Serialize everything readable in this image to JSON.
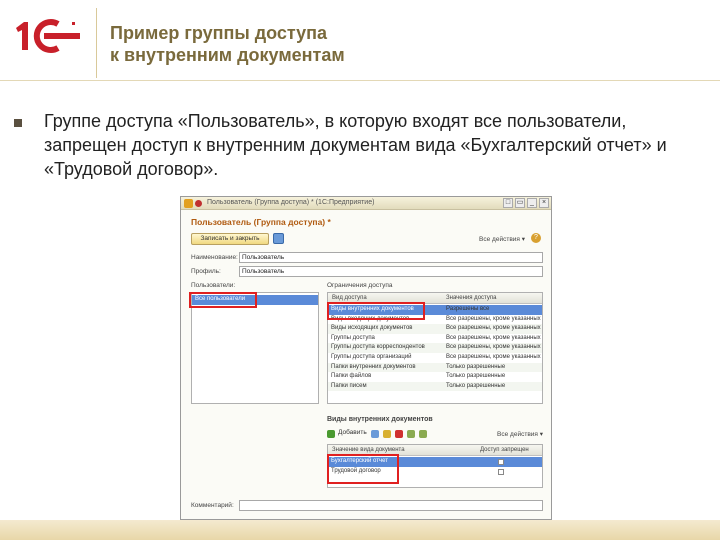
{
  "slide": {
    "logo": "1С",
    "title": "Пример группы доступа\nк внутренним документам",
    "bullet": "Группе доступа «Пользователь», в которую входят все пользователи, запрещен доступ к внутренним документам вида «Бухгалтерский отчет» и «Трудовой договор»."
  },
  "window": {
    "title": "Пользователь (Группа доступа) * (1С:Предприятие)",
    "buttons": [
      "□",
      "▭",
      "_",
      "×"
    ],
    "heading": "Пользователь (Группа доступа) *",
    "save_button": "Записать и закрыть",
    "all_actions": "Все действия ▾",
    "help": "?",
    "name_label": "Наименование:",
    "name_value": "Пользователь",
    "profile_label": "Профиль:",
    "profile_value": "Пользователь",
    "users_label": "Пользователи:",
    "users": [
      "Все пользователи"
    ],
    "restrictions_label": "Ограничения доступа",
    "restrictions_headers": [
      "Вид доступа",
      "Значения доступа"
    ],
    "restrictions": [
      {
        "kind": "Виды внутренних документов",
        "value": "Разрешены все"
      },
      {
        "kind": "Виды входящих документов",
        "value": "Все разрешены, кроме указанных"
      },
      {
        "kind": "Виды исходящих документов",
        "value": "Все разрешены, кроме указанных"
      },
      {
        "kind": "Группы доступа",
        "value": "Все разрешены, кроме указанных"
      },
      {
        "kind": "Группы доступа корреспондентов",
        "value": "Все разрешены, кроме указанных"
      },
      {
        "kind": "Группы доступа организаций",
        "value": "Все разрешены, кроме указанных"
      },
      {
        "kind": "Папки внутренних документов",
        "value": "Только разрешенные"
      },
      {
        "kind": "Папки файлов",
        "value": "Только разрешенные"
      },
      {
        "kind": "Папки писем",
        "value": "Только разрешенные"
      }
    ],
    "doc_types_label": "Виды внутренних документов",
    "add_button": "Добавить",
    "doc_headers": [
      "Значение вида документа",
      "Доступ запрещен"
    ],
    "doc_types": [
      "Бухгалтерский отчет",
      "Трудовой договор"
    ],
    "comment_label": "Комментарий:",
    "comment_value": ""
  }
}
